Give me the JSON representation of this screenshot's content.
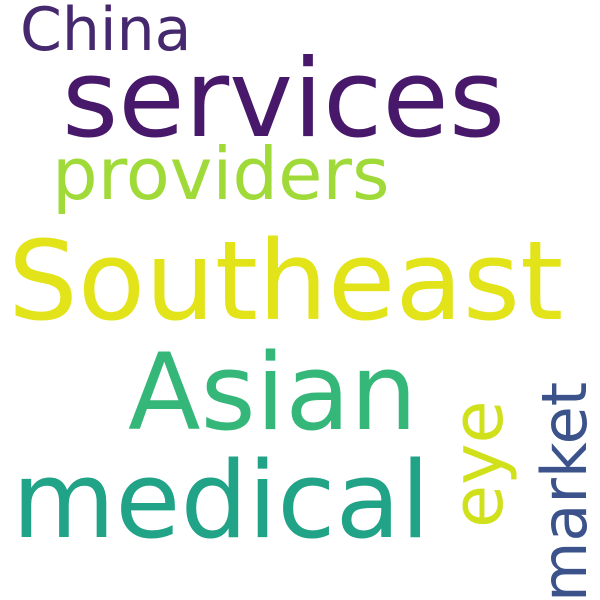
{
  "words": {
    "china": {
      "text": "China",
      "color": "#46286e"
    },
    "services": {
      "text": "services",
      "color": "#48186a"
    },
    "providers": {
      "text": "providers",
      "color": "#a0da39"
    },
    "southeast": {
      "text": "Southeast",
      "color": "#e2e318"
    },
    "asian": {
      "text": "Asian",
      "color": "#35b779"
    },
    "medical": {
      "text": "medical",
      "color": "#20a386"
    },
    "eye": {
      "text": "eye",
      "color": "#d0e11c"
    },
    "market": {
      "text": "market",
      "color": "#3b528b"
    }
  }
}
